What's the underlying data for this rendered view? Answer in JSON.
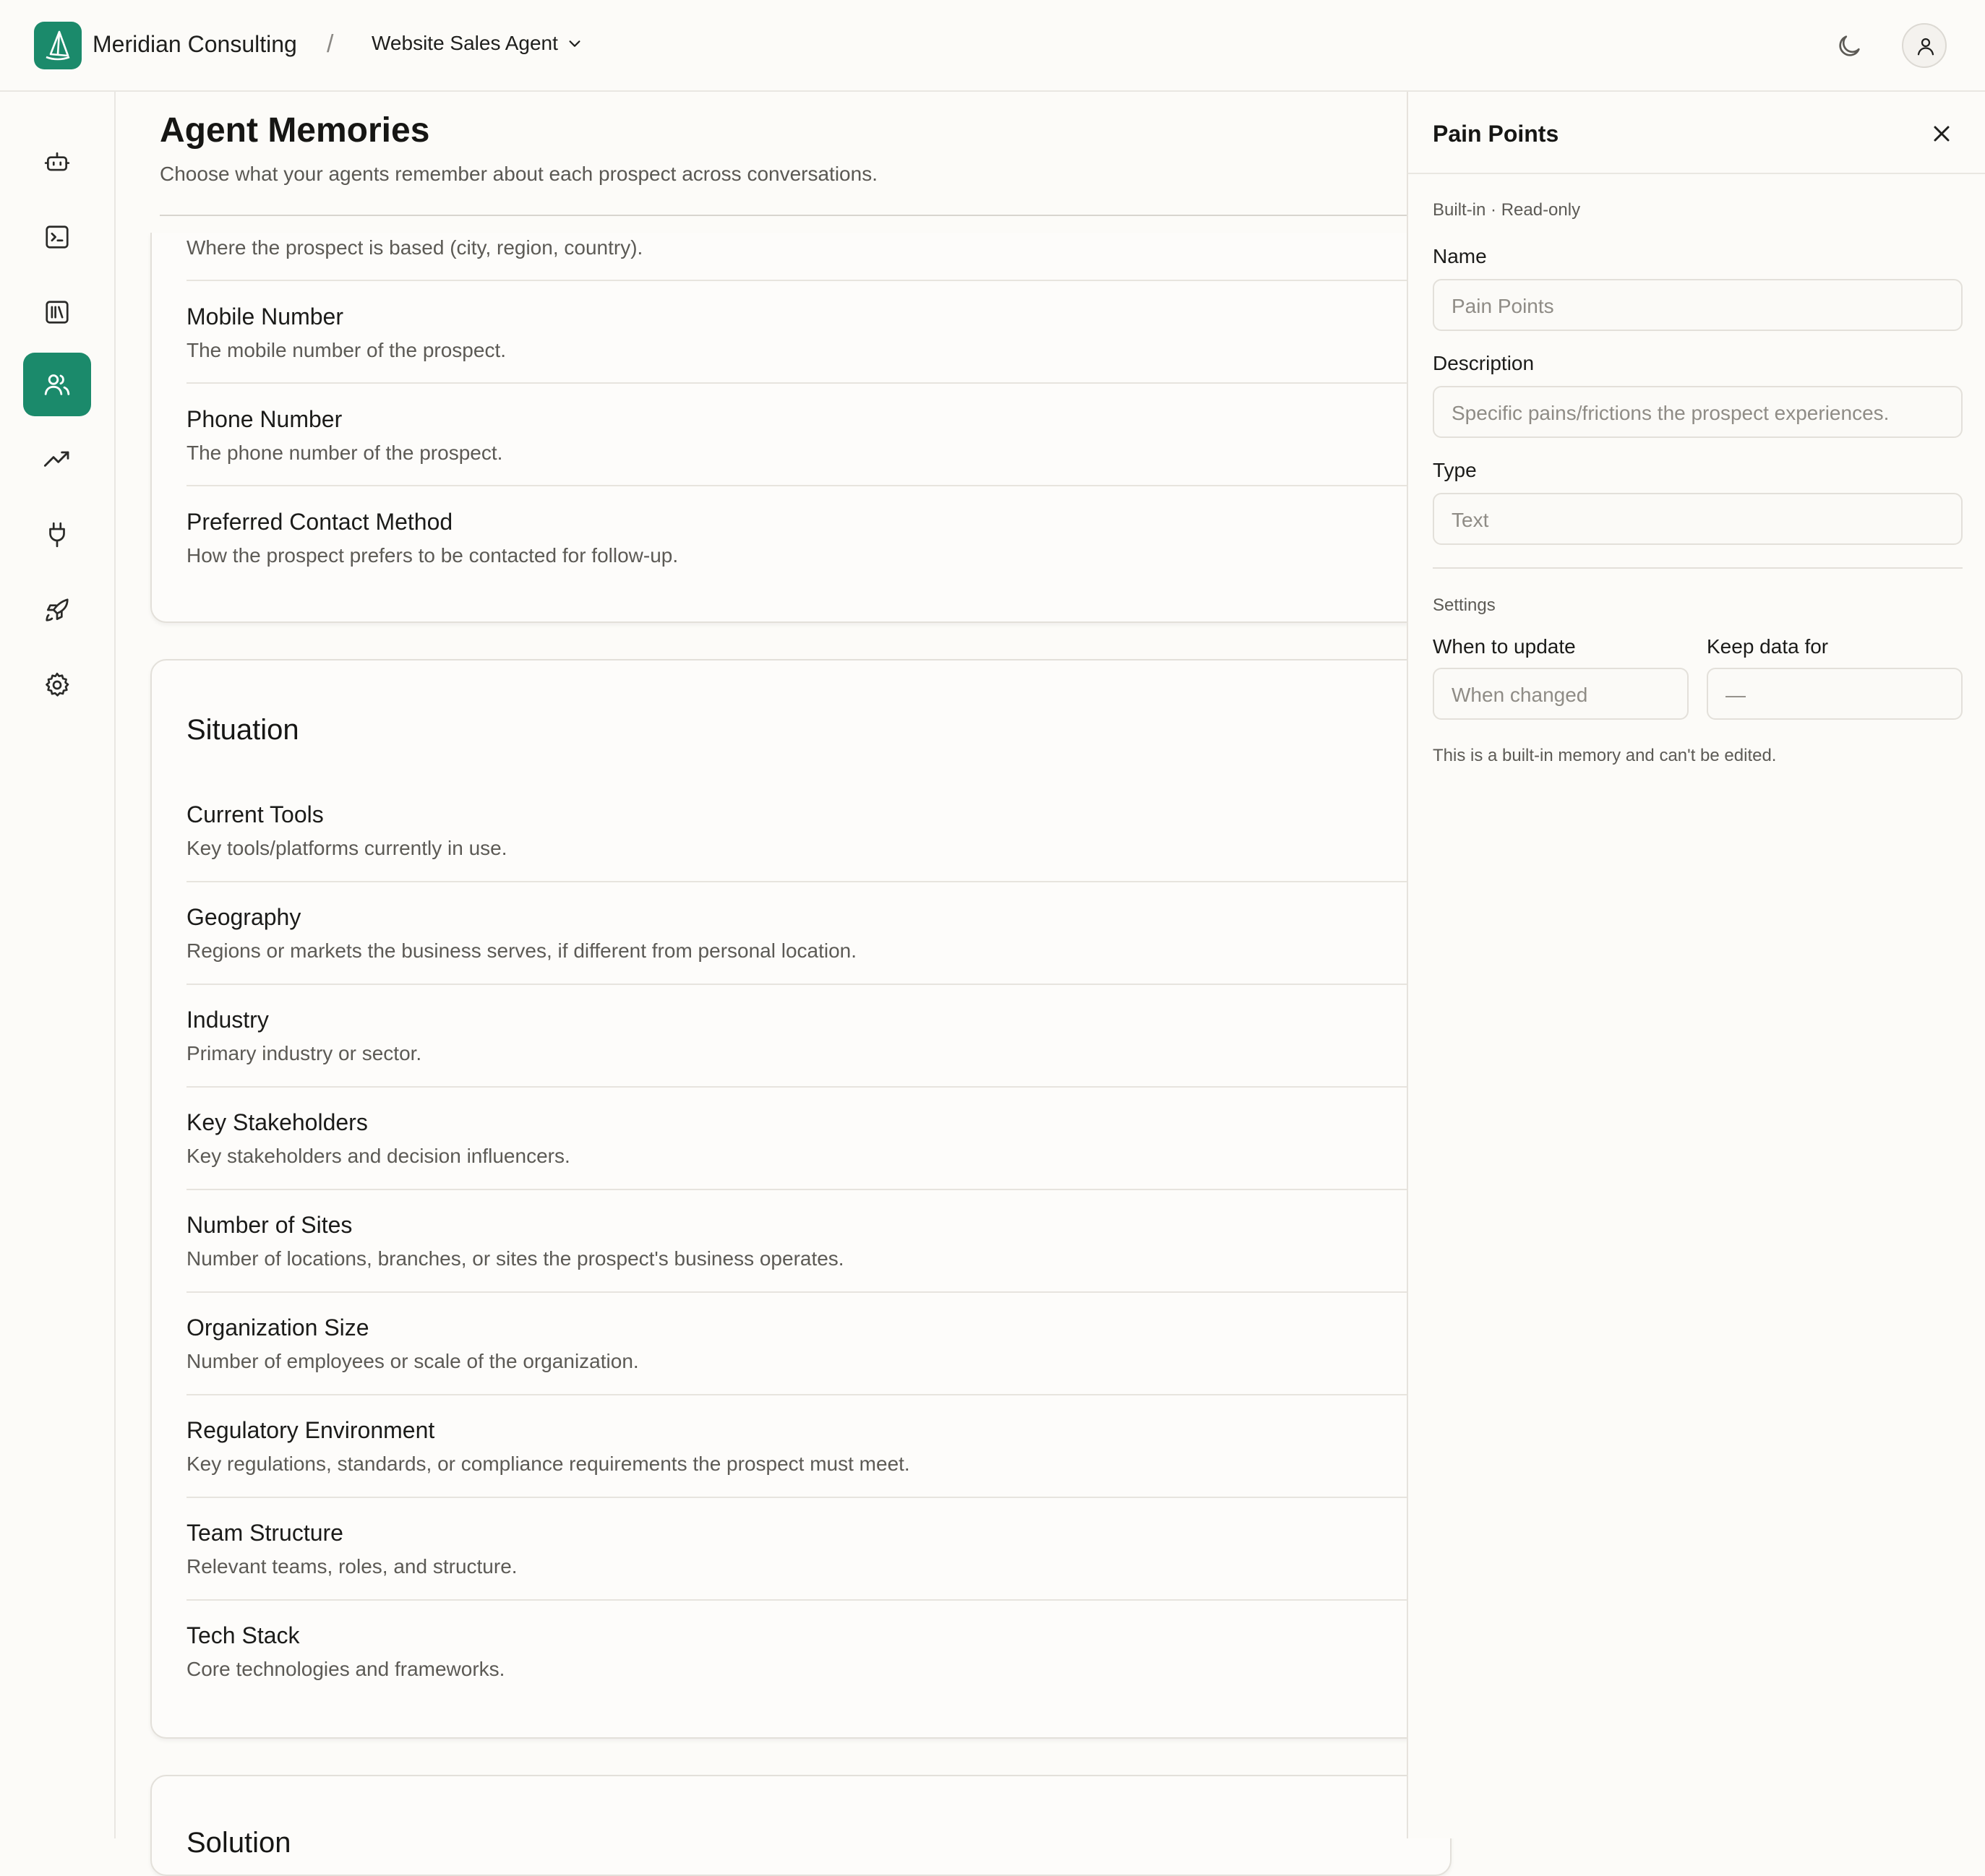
{
  "header": {
    "org_name": "Meridian Consulting",
    "separator": "/",
    "agent_name": "Website Sales Agent"
  },
  "nav": {
    "items": [
      "robot-icon",
      "terminal-icon",
      "library-icon",
      "users-icon",
      "trending-icon",
      "plug-icon",
      "rocket-icon",
      "settings-icon"
    ],
    "active": "users-icon",
    "accent": "#1b8a6b"
  },
  "page": {
    "title": "Agent Memories",
    "subtitle": "Choose what your agents remember about each prospect across conversations."
  },
  "contact_section": {
    "items": [
      {
        "description": "Where the prospect is based (city, region, country)."
      },
      {
        "title": "Mobile Number",
        "description": "The mobile number of the prospect."
      },
      {
        "title": "Phone Number",
        "description": "The phone number of the prospect."
      },
      {
        "title": "Preferred Contact Method",
        "description": "How the prospect prefers to be contacted for follow-up."
      }
    ]
  },
  "situation_section": {
    "title": "Situation",
    "items": [
      {
        "title": "Current Tools",
        "description": "Key tools/platforms currently in use."
      },
      {
        "title": "Geography",
        "description": "Regions or markets the business serves, if different from personal location."
      },
      {
        "title": "Industry",
        "description": "Primary industry or sector."
      },
      {
        "title": "Key Stakeholders",
        "description": "Key stakeholders and decision influencers."
      },
      {
        "title": "Number of Sites",
        "description": "Number of locations, branches, or sites the prospect's business operates."
      },
      {
        "title": "Organization Size",
        "description": "Number of employees or scale of the organization."
      },
      {
        "title": "Regulatory Environment",
        "description": "Key regulations, standards, or compliance requirements the prospect must meet."
      },
      {
        "title": "Team Structure",
        "description": "Relevant teams, roles, and structure."
      },
      {
        "title": "Tech Stack",
        "description": "Core technologies and frameworks."
      }
    ]
  },
  "next_section": {
    "title": "Solution"
  },
  "panel": {
    "title": "Pain Points",
    "meta": "Built-in · Read-only",
    "name_label": "Name",
    "name_value": "Pain Points",
    "description_label": "Description",
    "description_value": "Specific pains/frictions the prospect experiences.",
    "type_label": "Type",
    "type_value": "Text",
    "settings_label": "Settings",
    "update_label": "When to update",
    "update_value": "When changed",
    "keep_label": "Keep data for",
    "keep_value": "—",
    "note": "This is a built-in memory and can't be edited."
  }
}
